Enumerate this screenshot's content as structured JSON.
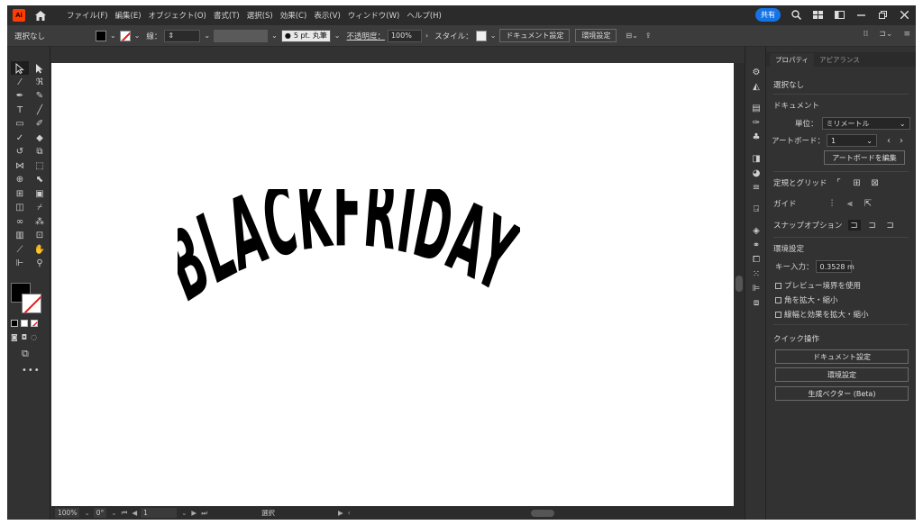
{
  "menubar": {
    "logo": "Ai",
    "items": [
      "ファイル(F)",
      "編集(E)",
      "オブジェクト(O)",
      "書式(T)",
      "選択(S)",
      "効果(C)",
      "表示(V)",
      "ウィンドウ(W)",
      "ヘルプ(H)"
    ],
    "share_label": "共有"
  },
  "controlbar": {
    "selection_status": "選択なし",
    "stroke_label": "線：",
    "brush_label": "5 pt. 丸筆",
    "opacity_label": "不透明度：",
    "opacity_value": "100%",
    "style_label": "スタイル：",
    "doc_settings_label": "ドキュメント設定",
    "preferences_label": "環境設定"
  },
  "artwork": {
    "text": "BLACKFRIDAY"
  },
  "statusbar": {
    "zoom": "100%",
    "rotation": "0°",
    "artboard_index": "1",
    "tool_label": "選択"
  },
  "properties": {
    "tabs": [
      "プロパティ",
      "アピアランス"
    ],
    "selection_status": "選択なし",
    "document_title": "ドキュメント",
    "units_label": "単位：",
    "units_value": "ミリメートル",
    "artboard_label": "アートボード：",
    "artboard_value": "1",
    "edit_artboard_label": "アートボードを編集",
    "rulers_grids_label": "定規とグリッド",
    "guides_label": "ガイド",
    "snap_label": "スナップオプション",
    "prefs_section": "環境設定",
    "key_increment_label": "キー入力：",
    "key_increment_value": "0.3528 m",
    "option_preview_bounds": "プレビュー境界を使用",
    "option_scale_corners": "角を拡大・縮小",
    "option_scale_strokes": "線幅と効果を拡大・縮小",
    "quick_actions_title": "クイック操作",
    "quick_doc_settings": "ドキュメント設定",
    "quick_preferences": "環境設定",
    "quick_generate_vectors": "生成ベクター (Beta)"
  },
  "colors": {
    "accent": "#1473e6",
    "panel": "#323232",
    "menubar": "#2b2b2b",
    "logo": "#ff3d00"
  }
}
